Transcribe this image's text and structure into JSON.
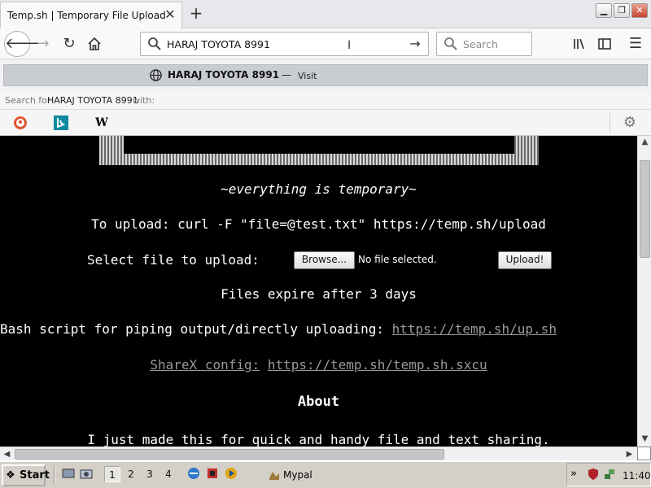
{
  "browser": {
    "tab_title": "Temp.sh | Temporary File Upload",
    "url_text": "HARAJ TOYOTA 8991",
    "search_placeholder": "Search",
    "suggestion": {
      "text": "HARAJ TOYOTA 8991",
      "dash": "—",
      "action": "Visit"
    },
    "search_for": {
      "prefix": "Search for",
      "query": "HARAJ TOYOTA 8991",
      "suffix": "with:"
    },
    "engines": [
      "duckduckgo-icon",
      "bing-icon",
      "wikipedia-icon"
    ],
    "wikipedia_label": "W"
  },
  "page": {
    "tagline": "~everything is temporary~",
    "upload_cmd": "To upload: curl -F \"file=@test.txt\" https://temp.sh/upload",
    "select_label": "Select file to upload:",
    "browse_label": "Browse...",
    "no_file": "No file selected.",
    "upload_label": "Upload!",
    "expire": "Files expire after 3 days",
    "bash_label": "Bash script for piping output/directly uploading:",
    "bash_link": "https://temp.sh/up.sh",
    "sharex_label": "ShareX config:",
    "sharex_link": "https://temp.sh/temp.sh.sxcu",
    "about_heading": "About",
    "about_text": "I just made this for quick and handy file and text sharing."
  },
  "taskbar": {
    "start_label": "Start",
    "desktops": [
      "1",
      "2",
      "3",
      "4"
    ],
    "app_label": "Mypal",
    "clock": "11:40",
    "tray_chevron": "»"
  }
}
